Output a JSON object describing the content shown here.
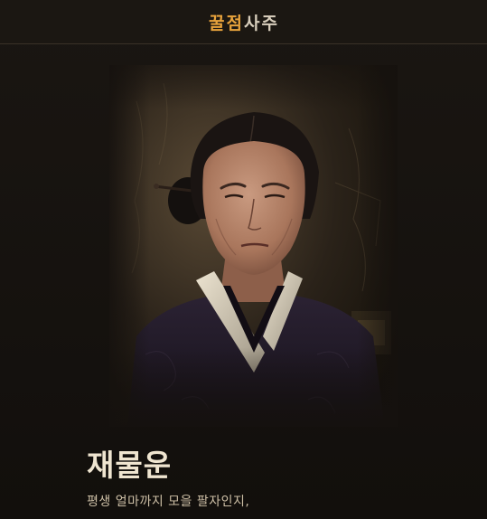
{
  "header": {
    "brand_chars": [
      "꿀",
      "점",
      "사",
      "주"
    ],
    "brand_colors": [
      "#e8a33c",
      "#e8a33c",
      "#d9cfbd",
      "#d9cfbd"
    ]
  },
  "main": {
    "portrait_icon": "portrait-image",
    "title": "재물운",
    "description": "평생 얼마까지 모을 팔자인지,"
  }
}
